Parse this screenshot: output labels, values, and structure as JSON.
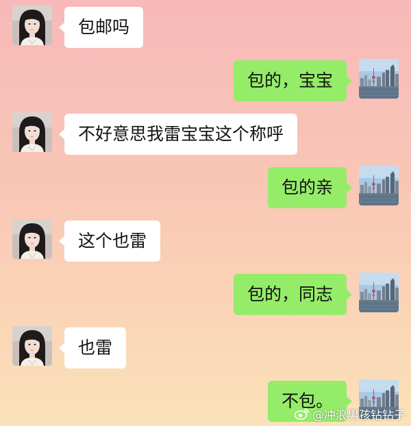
{
  "chat": {
    "messages": [
      {
        "from": "other",
        "text": "包邮吗"
      },
      {
        "from": "me",
        "text": "包的，宝宝"
      },
      {
        "from": "other",
        "text": "不好意思我雷宝宝这个称呼"
      },
      {
        "from": "me",
        "text": "包的亲"
      },
      {
        "from": "other",
        "text": "这个也雷"
      },
      {
        "from": "me",
        "text": "包的，同志"
      },
      {
        "from": "other",
        "text": "也雷"
      },
      {
        "from": "me",
        "text": "不包。"
      }
    ]
  },
  "watermark": {
    "text": "@冲浪男孩钻钻子"
  },
  "colors": {
    "incoming_bubble": "#ffffff",
    "outgoing_bubble": "#95ec69",
    "background_top": "#f7b9b9",
    "background_bottom": "#fbe2b8"
  },
  "icons": {
    "other_avatar": "woman-portrait-avatar",
    "my_avatar": "city-skyline-avatar",
    "watermark": "weibo-icon"
  }
}
